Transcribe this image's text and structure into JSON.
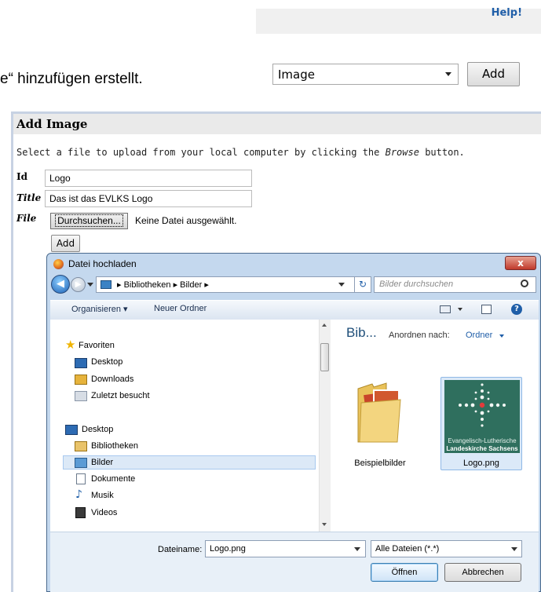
{
  "help_link": "Help!",
  "intro_text": "e“ hinzufügen erstellt.",
  "type_select": {
    "value": "Image"
  },
  "add_top_label": "Add",
  "panel": {
    "title": "Add Image",
    "desc_prefix": "Select a file to upload from your local computer by clicking the ",
    "desc_em": "Browse",
    "desc_suffix": " button.",
    "id_label": "Id",
    "id_value": "Logo",
    "title_label": "Title",
    "title_value": "Das ist das EVLKS Logo",
    "file_label": "File",
    "browse_label": "Durchsuchen...",
    "no_file": "Keine Datei ausgewählt.",
    "add_label": "Add"
  },
  "dialog": {
    "title": "Datei hochladen",
    "close": "x",
    "breadcrumb": "▸  Bibliotheken  ▸  Bilder  ▸",
    "search_placeholder": "Bilder durchsuchen",
    "organize": "Organisieren ▾",
    "new_folder": "Neuer Ordner",
    "nav": {
      "favorites": "Favoriten",
      "fav_desktop": "Desktop",
      "fav_downloads": "Downloads",
      "fav_recent": "Zuletzt besucht",
      "desktop": "Desktop",
      "libraries": "Bibliotheken",
      "pictures": "Bilder",
      "documents": "Dokumente",
      "music": "Musik",
      "videos": "Videos"
    },
    "library_title": "Bib...",
    "sort_label": "Anordnen nach:",
    "sort_value": "Ordner",
    "files": [
      {
        "name": "Beispielbilder"
      },
      {
        "name": "Logo.png"
      }
    ],
    "logo_text_line1": "Evangelisch-Lutherische",
    "logo_text_line2": "Landeskirche Sachsens",
    "filename_label": "Dateiname:",
    "filename_value": "Logo.png",
    "filetype_value": "Alle Dateien (*.*)",
    "open_label": "Öffnen",
    "cancel_label": "Abbrechen"
  },
  "colors": {
    "link": "#1f5ea8",
    "dialog_frame": "#c4d8ee",
    "selected": "#dce9f7"
  }
}
